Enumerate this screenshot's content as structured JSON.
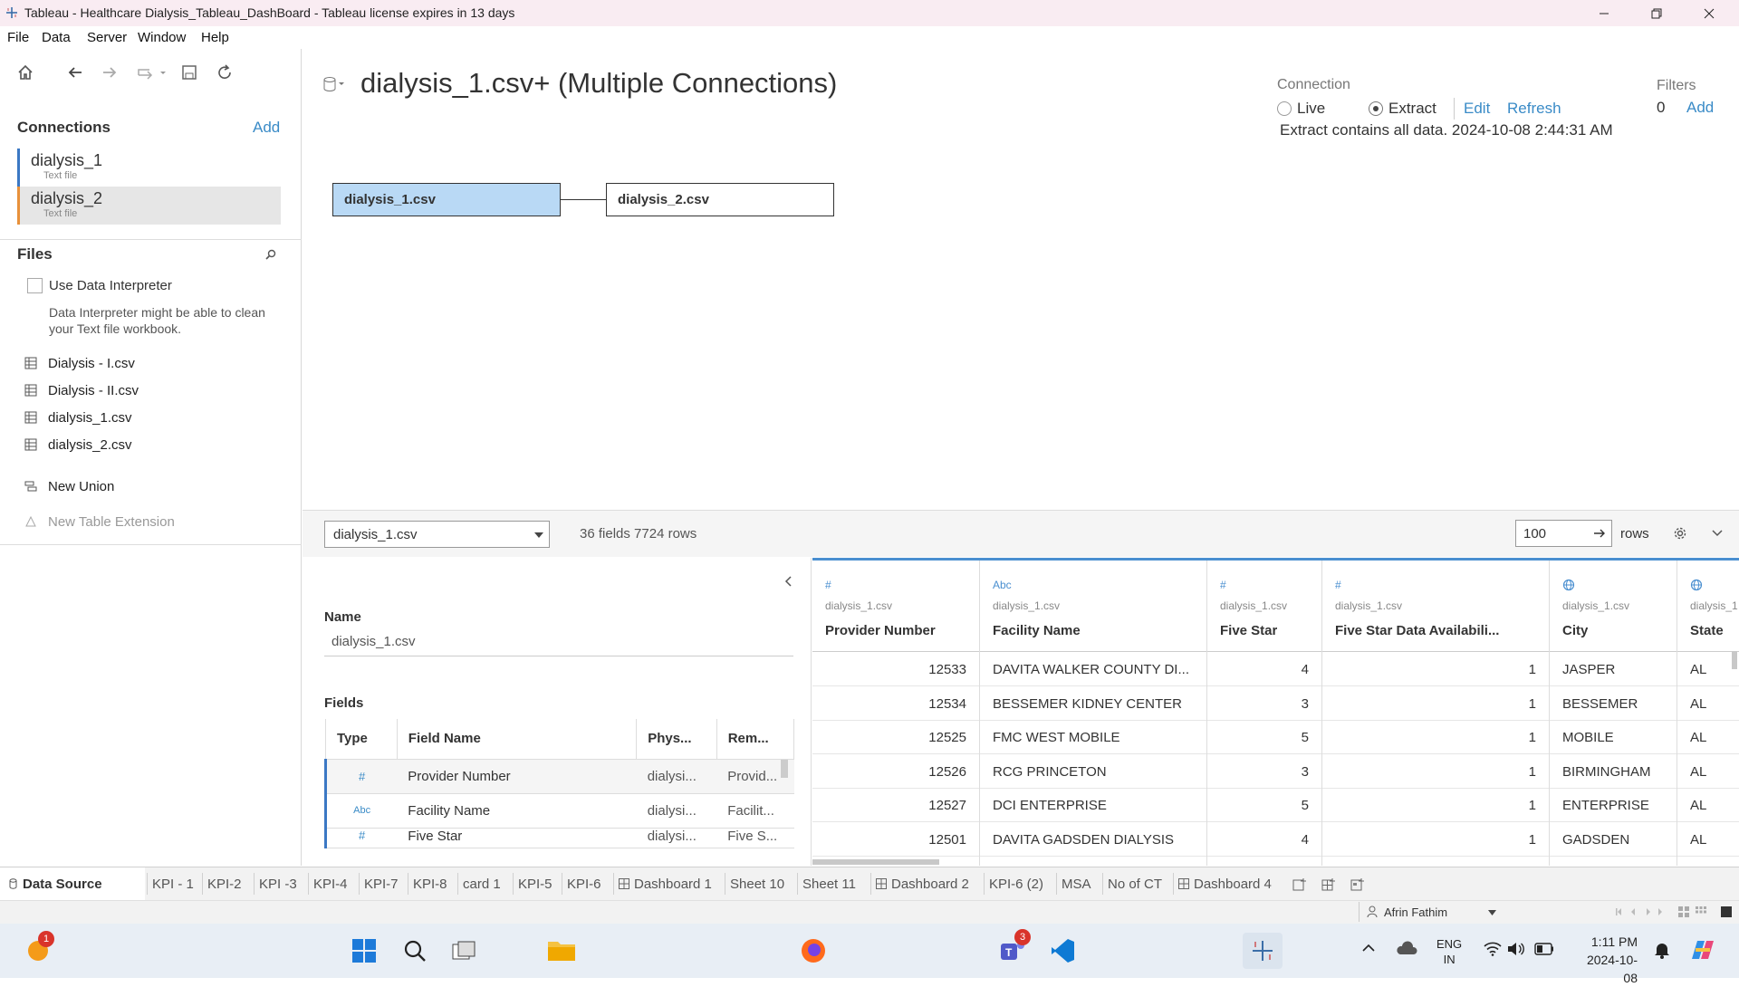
{
  "window": {
    "title": "Tableau - Healthcare Dialysis_Tableau_DashBoard - Tableau license expires in 13 days"
  },
  "menu": [
    "File",
    "Data",
    "Server",
    "Window",
    "Help"
  ],
  "left": {
    "connections_title": "Connections",
    "add_label": "Add",
    "connections": [
      {
        "name": "dialysis_1",
        "type": "Text file"
      },
      {
        "name": "dialysis_2",
        "type": "Text file"
      }
    ],
    "files_title": "Files",
    "interpreter_label": "Use Data Interpreter",
    "interpreter_hint": "Data Interpreter might be able to clean your Text file workbook.",
    "files": [
      "Dialysis - I.csv",
      "Dialysis - II.csv",
      "dialysis_1.csv",
      "dialysis_2.csv"
    ],
    "new_union": "New Union",
    "new_table_extension": "New Table Extension"
  },
  "canvas": {
    "title": "dialysis_1.csv+ (Multiple Connections)",
    "tables": [
      "dialysis_1.csv",
      "dialysis_2.csv"
    ]
  },
  "connection": {
    "label": "Connection",
    "live": "Live",
    "extract": "Extract",
    "selected": "Extract",
    "edit": "Edit",
    "refresh": "Refresh",
    "extract_info": "Extract contains all data. 2024-10-08 2:44:31 AM",
    "filters_label": "Filters",
    "filters_count": "0",
    "filters_add": "Add"
  },
  "gridbar": {
    "table_select": "dialysis_1.csv",
    "summary": "36 fields 7724 rows",
    "rows_value": "100",
    "rows_label": "rows"
  },
  "meta": {
    "name_label": "Name",
    "name_value": "dialysis_1.csv",
    "fields_label": "Fields",
    "columns": [
      "Type",
      "Field Name",
      "Phys...",
      "Rem..."
    ],
    "rows": [
      {
        "type": "#",
        "name": "Provider Number",
        "phys": "dialysi...",
        "rem": "Provid..."
      },
      {
        "type": "Abc",
        "name": "Facility Name",
        "phys": "dialysi...",
        "rem": "Facilit..."
      },
      {
        "type": "#",
        "name": "Five Star",
        "phys": "dialysi...",
        "rem": "Five S..."
      }
    ]
  },
  "grid": {
    "columns": [
      {
        "icon": "#",
        "source": "dialysis_1.csv",
        "name": "Provider Number"
      },
      {
        "icon": "Abc",
        "source": "dialysis_1.csv",
        "name": "Facility Name"
      },
      {
        "icon": "#",
        "source": "dialysis_1.csv",
        "name": "Five Star"
      },
      {
        "icon": "#",
        "source": "dialysis_1.csv",
        "name": "Five Star Data Availabili..."
      },
      {
        "icon": "globe",
        "source": "dialysis_1.csv",
        "name": "City"
      },
      {
        "icon": "globe",
        "source": "dialysis_1",
        "name": "State"
      }
    ],
    "rows": [
      [
        "12533",
        "DAVITA WALKER COUNTY DI...",
        "4",
        "1",
        "JASPER",
        "AL"
      ],
      [
        "12534",
        "BESSEMER KIDNEY CENTER",
        "3",
        "1",
        "BESSEMER",
        "AL"
      ],
      [
        "12525",
        "FMC WEST MOBILE",
        "5",
        "1",
        "MOBILE",
        "AL"
      ],
      [
        "12526",
        "RCG PRINCETON",
        "3",
        "1",
        "BIRMINGHAM",
        "AL"
      ],
      [
        "12527",
        "DCI ENTERPRISE",
        "5",
        "1",
        "ENTERPRISE",
        "AL"
      ],
      [
        "12501",
        "DAVITA GADSDEN DIALYSIS",
        "4",
        "1",
        "GADSDEN",
        "AL"
      ]
    ]
  },
  "tabs": [
    "Data Source",
    "KPI - 1",
    "KPI-2",
    "KPI -3",
    "KPI-4",
    "KPI-7",
    "KPI-8",
    "card 1",
    "KPI-5",
    "KPI-6",
    "Dashboard 1",
    "Sheet 10",
    "Sheet 11",
    "Dashboard 2",
    "KPI-6 (2)",
    "MSA",
    "No of CT",
    "Dashboard 4"
  ],
  "status": {
    "user": "Afrin Fathim"
  },
  "taskbar": {
    "notif_badge": "1",
    "teams_badge": "3",
    "lang1": "ENG",
    "lang2": "IN",
    "time": "1:11 PM",
    "date": "2024-10-08"
  },
  "colors": {
    "accent": "#3a8bc7",
    "selected_table": "#b9d9f5",
    "conn_bar": "#3b78c4"
  }
}
